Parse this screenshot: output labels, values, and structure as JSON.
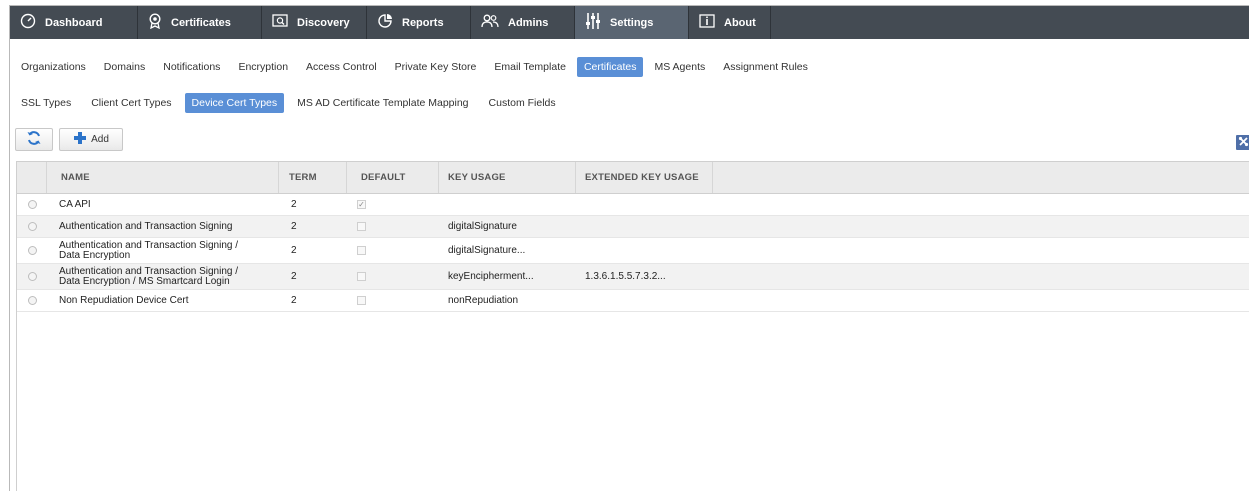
{
  "nav": {
    "items": [
      {
        "label": "Dashboard",
        "icon": "dashboard-icon"
      },
      {
        "label": "Certificates",
        "icon": "certificate-icon"
      },
      {
        "label": "Discovery",
        "icon": "discovery-icon"
      },
      {
        "label": "Reports",
        "icon": "reports-icon"
      },
      {
        "label": "Admins",
        "icon": "admins-icon"
      },
      {
        "label": "Settings",
        "icon": "settings-sliders-icon"
      },
      {
        "label": "About",
        "icon": "about-icon"
      }
    ],
    "active": "Settings"
  },
  "settings_tabs": [
    "Organizations",
    "Domains",
    "Notifications",
    "Encryption",
    "Access Control",
    "Private Key Store",
    "Email Template",
    "Certificates",
    "MS Agents",
    "Assignment Rules"
  ],
  "settings_tabs_active": "Certificates",
  "cert_tabs": [
    "SSL Types",
    "Client Cert Types",
    "Device Cert Types",
    "MS AD Certificate Template Mapping",
    "Custom Fields"
  ],
  "cert_tabs_active": "Device Cert Types",
  "toolbar": {
    "add_label": "Add",
    "refresh_icon": "refresh-icon",
    "tools_icon": "tools-icon"
  },
  "table": {
    "headers": {
      "name": "NAME",
      "term": "TERM",
      "default": "DEFAULT",
      "key_usage": "KEY USAGE",
      "ext_key_usage": "EXTENDED KEY USAGE"
    },
    "rows": [
      {
        "name1": "CA API",
        "name2": "",
        "term": "2",
        "default": true,
        "key_usage": "",
        "ext_key_usage": ""
      },
      {
        "name1": "Authentication and Transaction Signing",
        "name2": "",
        "term": "2",
        "default": false,
        "key_usage": "digitalSignature",
        "ext_key_usage": ""
      },
      {
        "name1": "Authentication and Transaction Signing /",
        "name2": "Data Encryption",
        "term": "2",
        "default": false,
        "key_usage": "digitalSignature...",
        "ext_key_usage": ""
      },
      {
        "name1": "Authentication and Transaction Signing /",
        "name2": "Data Encryption / MS Smartcard Login",
        "term": "2",
        "default": false,
        "key_usage": "keyEncipherment...",
        "ext_key_usage": "1.3.6.1.5.5.7.3.2..."
      },
      {
        "name1": "Non Repudiation Device Cert",
        "name2": "",
        "term": "2",
        "default": false,
        "key_usage": "nonRepudiation",
        "ext_key_usage": ""
      }
    ]
  },
  "colors": {
    "nav_bg": "#444b53",
    "nav_active": "#5a6572",
    "tab_active": "#5a8fd6",
    "add_plus": "#2b73c9"
  }
}
